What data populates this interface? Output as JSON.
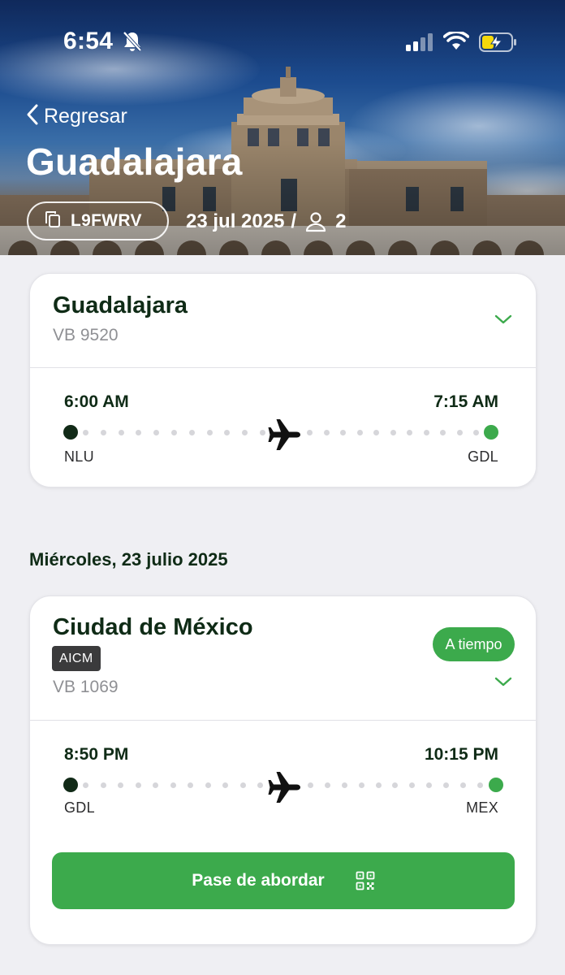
{
  "status_bar": {
    "time": "6:54",
    "icons": [
      "bell-slash-icon",
      "signal-icon",
      "wifi-icon",
      "battery-charging-icon"
    ]
  },
  "header": {
    "back_label": "Regresar",
    "title": "Guadalajara",
    "booking_code": "L9FWRV",
    "date": "23 jul 2025",
    "separator": "/",
    "passengers": "2"
  },
  "flights": [
    {
      "destination": "Guadalajara",
      "flight_number": "VB 9520",
      "departure_time": "6:00 AM",
      "arrival_time": "7:15 AM",
      "origin_code": "NLU",
      "destination_code": "GDL"
    },
    {
      "date_heading": "Miércoles, 23 julio 2025",
      "destination": "Ciudad de México",
      "airport_tag": "AICM",
      "status": "A tiempo",
      "flight_number": "VB 1069",
      "departure_time": "8:50 PM",
      "arrival_time": "10:15 PM",
      "origin_code": "GDL",
      "destination_code": "MEX",
      "boarding_pass_label": "Pase de abordar"
    }
  ],
  "colors": {
    "brand_green": "#3caa4c",
    "dark_green": "#0f2b16",
    "airport_tag_bg": "#3b3b3c",
    "background": "#efeff3"
  }
}
